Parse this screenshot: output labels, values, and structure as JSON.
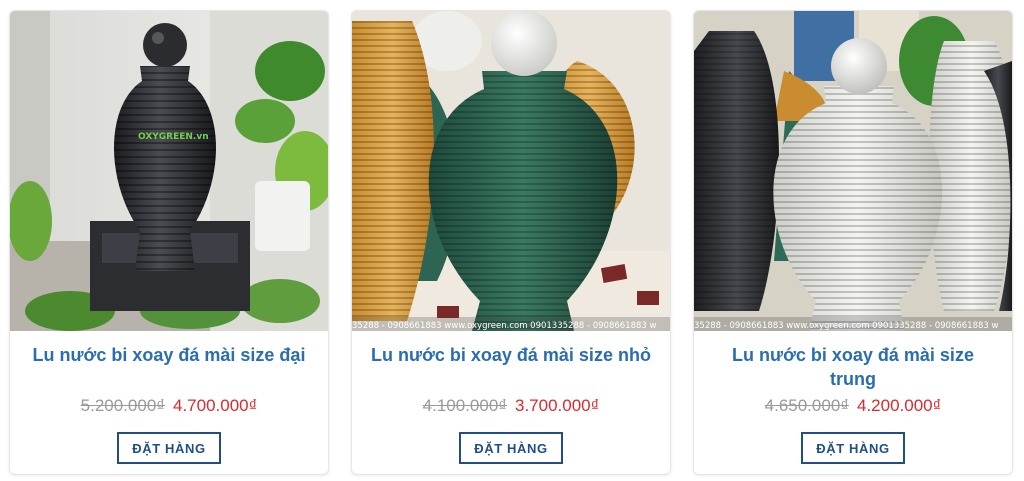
{
  "products": [
    {
      "title": "Lu nước bi xoay đá mài size đại",
      "old_price": "5.200.000₫",
      "new_price": "4.700.000₫",
      "button_label": "ĐẶT HÀNG",
      "logo_text": "OXYGREEN.vn"
    },
    {
      "title": "Lu nước bi xoay đá mài size nhỏ",
      "old_price": "4.100.000₫",
      "new_price": "3.700.000₫",
      "button_label": "ĐẶT HÀNG",
      "watermark": "35288 - 0908661883 www.oxygreen.com 0901335288 - 0908661883 w"
    },
    {
      "title": "Lu nước bi xoay đá mài size trung",
      "old_price": "4.650.000₫",
      "new_price": "4.200.000₫",
      "button_label": "ĐẶT HÀNG",
      "watermark": "35288 - 0908661883 www.oxygreen.com 0901335288 - 0908661883 w"
    }
  ],
  "colors": {
    "title_blue": "#2a6db3",
    "price_red": "#e0282f",
    "old_price_gray": "#9a9a9a",
    "button_navy": "#1f4f86"
  }
}
